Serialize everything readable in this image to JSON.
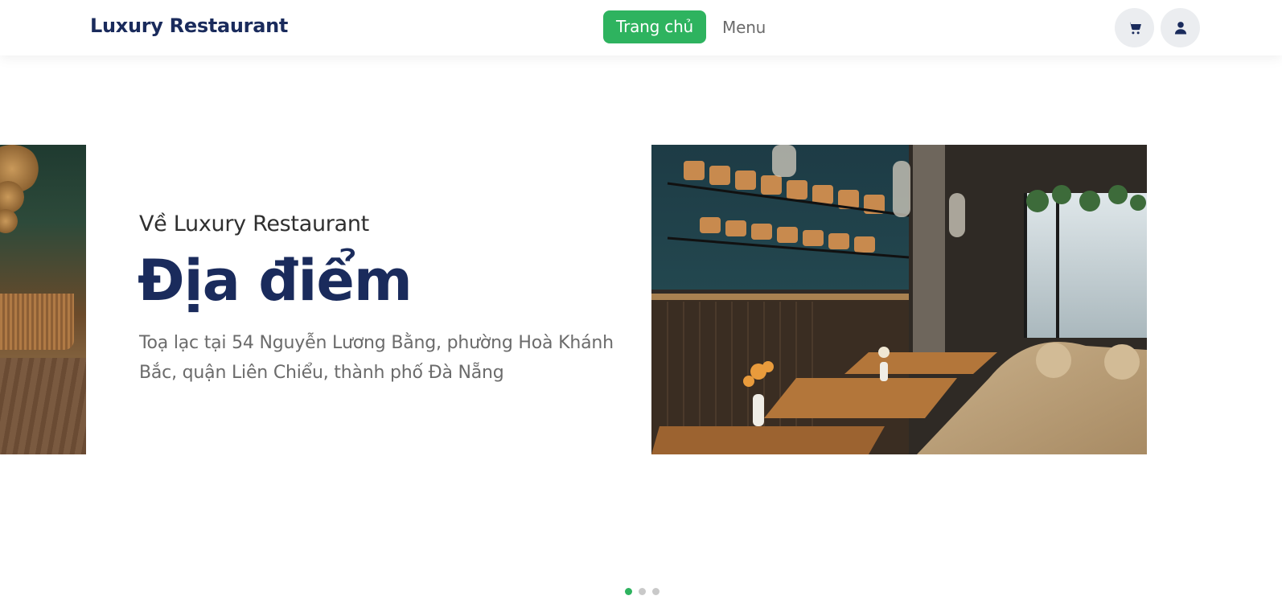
{
  "header": {
    "brand": "Luxury Restaurant",
    "nav": [
      {
        "label": "Trang chủ",
        "active": true
      },
      {
        "label": "Menu",
        "active": false
      }
    ],
    "icons": [
      "cart-icon",
      "user-icon"
    ]
  },
  "about": {
    "subtitle": "Về Luxury Restaurant",
    "title": "Địa điểm",
    "description": "Toạ lạc tại 54 Nguyễn Lương Bằng, phường Hoà Khánh Bắc, quận Liên Chiểu, thành phố Đà Nẵng"
  },
  "carousel": {
    "slide_count": 3,
    "active_index": 0
  },
  "colors": {
    "brand_navy": "#1a2b5c",
    "accent_green": "#2eb35f",
    "muted_text": "#6b6b6b"
  }
}
